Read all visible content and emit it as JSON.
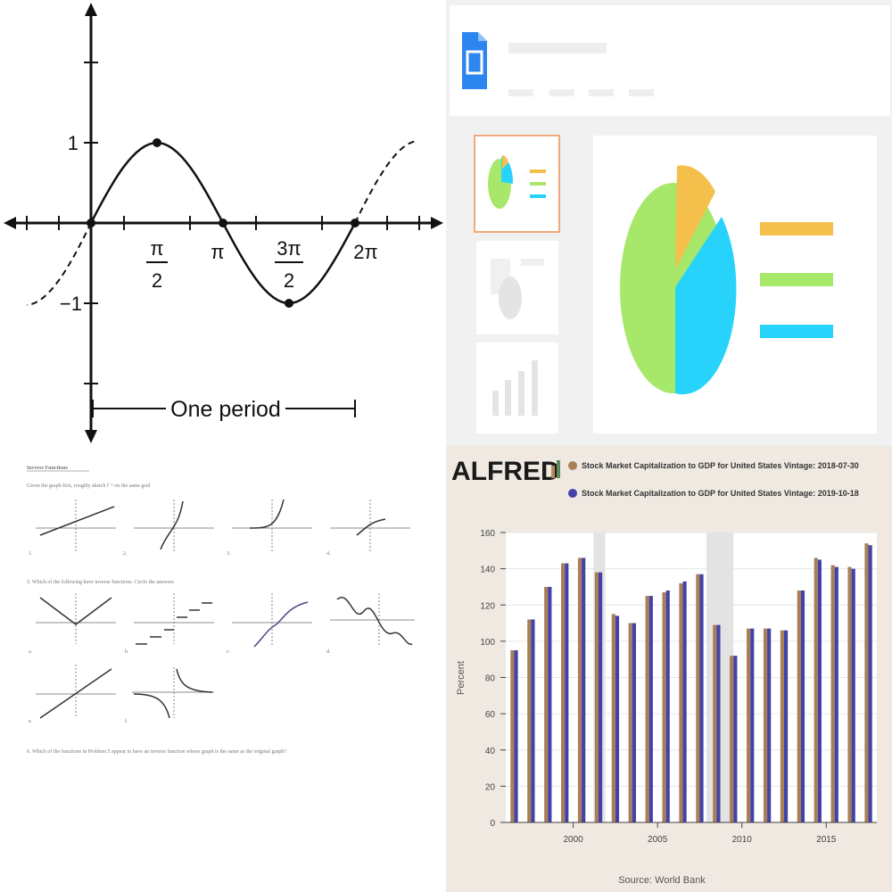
{
  "sine_graph": {
    "y_tick_labels": [
      "1",
      "−1"
    ],
    "x_tick_labels": [
      {
        "num": "π",
        "den": "2",
        "x": 1.5708
      },
      {
        "num": "π",
        "den": "",
        "x": 3.1416
      },
      {
        "num": "3π",
        "den": "2",
        "x": 4.7124
      },
      {
        "num": "2π",
        "den": "",
        "x": 6.2832
      }
    ],
    "period_label": "One period"
  },
  "slides_mockup": {
    "app_icon": "slides-doc-icon",
    "pie_colors": [
      "#f4c04b",
      "#27d3fb",
      "#a7e86a"
    ],
    "pie_values": [
      10,
      35,
      55
    ],
    "accent_border": "#f0a97a"
  },
  "worksheet": {
    "title": "Inverse Functions",
    "q1": "Given the graph first, roughly sketch f⁻¹ on the same grid",
    "q2": "5. Which of the following have inverse functions. Circle the answers",
    "q3": "6. Which of the functions in Problem 5 appear to have an inverse function whose graph is the same as the original graph?",
    "row1_labels": [
      "1.",
      "2.",
      "3.",
      "4."
    ],
    "row2_labels": [
      "a.",
      "b.",
      "c.",
      "d."
    ],
    "row3_labels": [
      "e.",
      "f."
    ]
  },
  "fred": {
    "logo_text": "ALFRED",
    "legend": [
      {
        "label": "Stock Market Capitalization to GDP for United States Vintage: 2018-07-30",
        "color": "#a87f56"
      },
      {
        "label": "Stock Market Capitalization to GDP for United States Vintage: 2019-10-18",
        "color": "#4242a8"
      }
    ],
    "source": "Source: World Bank",
    "chart_data": {
      "type": "bar",
      "x": [
        1996,
        1997,
        1998,
        1999,
        2000,
        2001,
        2002,
        2003,
        2004,
        2005,
        2006,
        2007,
        2008,
        2009,
        2010,
        2011,
        2012,
        2013,
        2014,
        2015,
        2016,
        2017
      ],
      "series": [
        {
          "name": "Stock Market Capitalization to GDP for United States Vintage: 2018-07-30",
          "values": [
            95,
            112,
            130,
            143,
            146,
            138,
            115,
            110,
            125,
            127,
            132,
            137,
            109,
            92,
            107,
            107,
            106,
            128,
            146,
            142,
            141,
            154
          ]
        },
        {
          "name": "Stock Market Capitalization to GDP for United States Vintage: 2019-10-18",
          "values": [
            95,
            112,
            130,
            143,
            146,
            138,
            114,
            110,
            125,
            128,
            133,
            137,
            109,
            92,
            107,
            107,
            106,
            128,
            145,
            141,
            140,
            153
          ]
        }
      ],
      "xlabel": "",
      "ylabel": "Percent",
      "ylim": [
        0,
        160
      ],
      "y_ticks": [
        0,
        20,
        40,
        60,
        80,
        100,
        120,
        140,
        160
      ],
      "x_tick_labels": [
        "2000",
        "2005",
        "2010",
        "2015"
      ],
      "recessions": [
        [
          2001.2,
          2001.9
        ],
        [
          2007.9,
          2009.5
        ]
      ],
      "grid": true
    }
  }
}
